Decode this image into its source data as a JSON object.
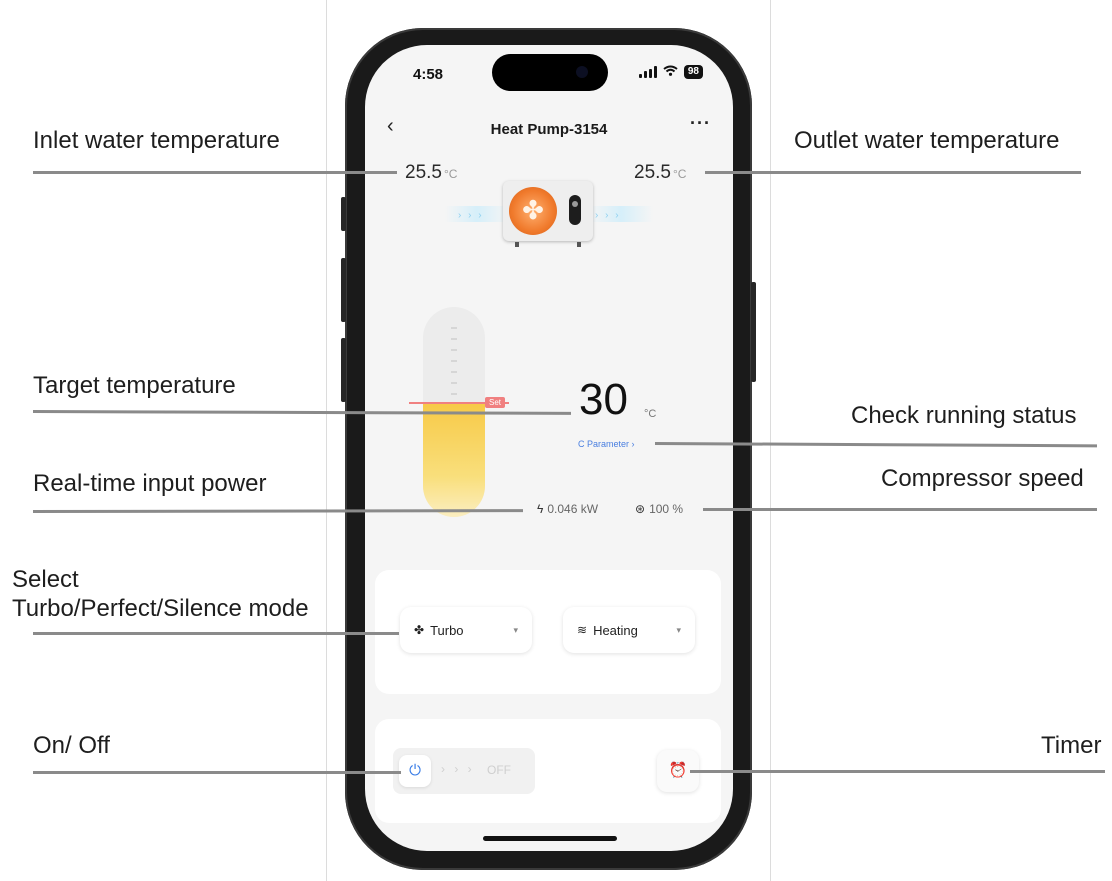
{
  "callouts": {
    "inlet": "Inlet water temperature",
    "outlet": "Outlet water temperature",
    "target": "Target temperature",
    "running": "Check running status",
    "power": "Real-time input power",
    "compressor": "Compressor speed",
    "mode_line1": "Select",
    "mode_line2": "Turbo/Perfect/Silence mode",
    "onoff": "On/ Off",
    "timer": "Timer"
  },
  "status_bar": {
    "time": "4:58",
    "battery": "98"
  },
  "nav": {
    "back": "‹",
    "title": "Heat Pump-3154",
    "more": "···"
  },
  "temperatures": {
    "inlet_value": "25.5",
    "outlet_value": "25.5",
    "unit": "°C"
  },
  "flow_arrows": "› › ›",
  "target": {
    "value": "30",
    "unit": "°C",
    "set_badge": "Set",
    "slider_level_fraction": 0.55
  },
  "parameter_link": "C Parameter ›",
  "metrics": {
    "power": "0.046 kW",
    "compressor_speed": "100 %"
  },
  "mode_card": {
    "mode_label": "Turbo",
    "function_label": "Heating"
  },
  "control_card": {
    "power_label": "OFF",
    "arrows": "› › ›"
  },
  "icons": {
    "power": "⏻",
    "timer": "⏰",
    "bolt": "ϟ",
    "gauge": "⊛",
    "fan": "✤",
    "heat": "≋",
    "caret": "▾"
  },
  "colors": {
    "accent_blue": "#3a7de6",
    "link_blue": "#4a7fe0",
    "set_red": "#f08080",
    "fill_yellow": "#f7c946",
    "fan_orange": "#f07a2c"
  }
}
